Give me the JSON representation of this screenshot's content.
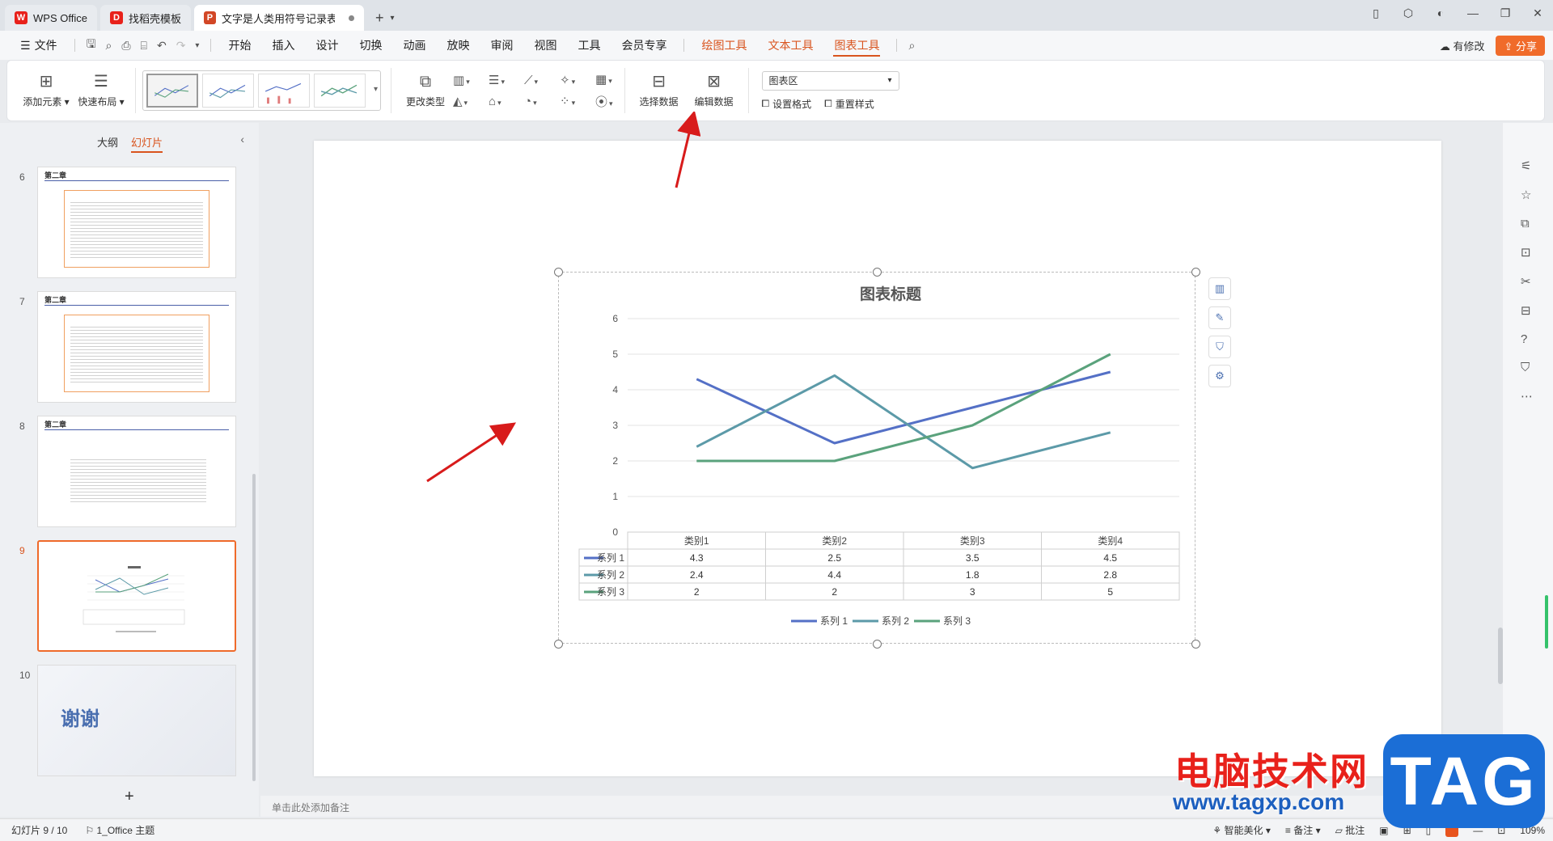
{
  "tabs": [
    {
      "label": "WPS Office",
      "logo": "W",
      "color": "#e8211b"
    },
    {
      "label": "找稻壳模板",
      "logo": "D",
      "color": "#e8211b"
    },
    {
      "label": "文字是人类用符号记录表达信息以",
      "logo": "P",
      "color": "#d24726"
    }
  ],
  "menu": {
    "file": "文件",
    "items": [
      "开始",
      "插入",
      "设计",
      "切换",
      "动画",
      "放映",
      "审阅",
      "视图",
      "工具",
      "会员专享"
    ],
    "context": [
      "绘图工具",
      "文本工具",
      "图表工具"
    ],
    "selected": "图表工具",
    "modified": "有修改",
    "share": "分享"
  },
  "ribbon": {
    "add_element": "添加元素",
    "quick_layout": "快速布局",
    "change_type": "更改类型",
    "select_data": "选择数据",
    "edit_data": "编辑数据",
    "chart_area": "图表区",
    "set_format": "设置格式",
    "reset_style": "重置样式"
  },
  "left_panel": {
    "tab_outline": "大纲",
    "tab_slides": "幻灯片",
    "slides": [
      {
        "num": "6",
        "title": "第二章"
      },
      {
        "num": "7",
        "title": "第二章"
      },
      {
        "num": "8",
        "title": "第二章"
      },
      {
        "num": "9",
        "title": ""
      },
      {
        "num": "10",
        "title": "谢谢"
      }
    ],
    "add": "+"
  },
  "chart_data": {
    "type": "line",
    "title": "图表标题",
    "categories": [
      "类别1",
      "类别2",
      "类别3",
      "类别4"
    ],
    "series": [
      {
        "name": "系列 1",
        "color": "#5470c6",
        "values": [
          4.3,
          2.5,
          3.5,
          4.5
        ]
      },
      {
        "name": "系列 2",
        "color": "#5c9aa8",
        "values": [
          2.4,
          4.4,
          1.8,
          2.8
        ]
      },
      {
        "name": "系列 3",
        "color": "#5aa27c",
        "values": [
          2,
          2,
          3,
          5
        ]
      }
    ],
    "ylim": [
      0,
      6
    ],
    "yticks": [
      0,
      1,
      2,
      3,
      4,
      5,
      6
    ],
    "grid": true,
    "legend": "bottom",
    "data_table": true
  },
  "notes_placeholder": "单击此处添加备注",
  "status": {
    "slide": "幻灯片 9 / 10",
    "theme": "1_Office 主题",
    "beautify": "智能美化",
    "notes": "备注",
    "comments": "批注",
    "zoom": "109%"
  },
  "watermark": {
    "cn": "电脑技术网",
    "url": "www.tagxp.com",
    "tag": "TAG"
  }
}
